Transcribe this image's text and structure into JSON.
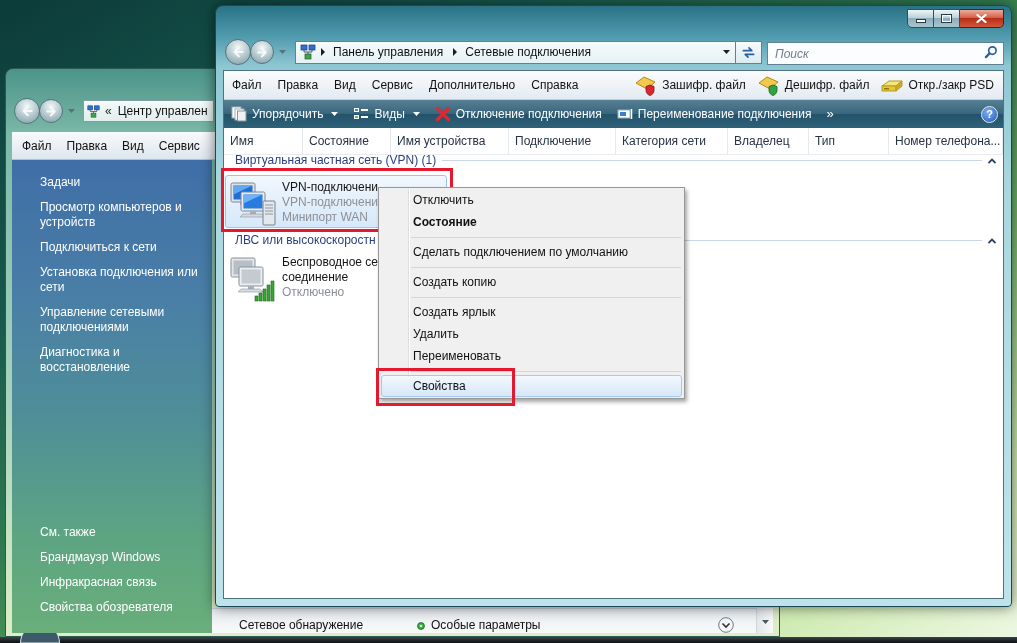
{
  "back_window": {
    "address": {
      "overflow": "«",
      "location": "Центр управлен"
    },
    "menu": [
      "Файл",
      "Правка",
      "Вид",
      "Сервис"
    ],
    "sidebar": [
      {
        "heading": "Задачи",
        "links": [
          "Просмотр компьютеров и устройств",
          "Подключиться к сети",
          "Установка подключения или сети",
          "Управление сетевыми подключениями",
          "Диагностика и восстановление"
        ]
      },
      {
        "heading": "См. также",
        "links": [
          "Брандмауэр Windows",
          "Инфракрасная связь",
          "Свойства обозревателя"
        ]
      }
    ],
    "details_row": {
      "label": "Сетевое обнаружение",
      "value": "Особые параметры"
    }
  },
  "front_window": {
    "address": {
      "path": [
        "Панель управления",
        "Сетевые подключения"
      ]
    },
    "search": {
      "placeholder": "Поиск"
    },
    "menu": [
      "Файл",
      "Правка",
      "Вид",
      "Сервис",
      "Дополнительно",
      "Справка"
    ],
    "tools": [
      {
        "kind": "encrypt",
        "label": "Зашифр. файл"
      },
      {
        "kind": "decrypt",
        "label": "Дешифр. файл"
      },
      {
        "kind": "drive",
        "label": "Откр./закр PSD"
      }
    ],
    "commands": [
      {
        "kind": "organize",
        "label": "Упорядочить",
        "dropdown": true
      },
      {
        "kind": "views",
        "label": "Виды",
        "dropdown": true
      },
      {
        "kind": "disconnect",
        "label": "Отключение подключения",
        "dropdown": false
      },
      {
        "kind": "rename",
        "label": "Переименование подключения",
        "dropdown": false
      }
    ],
    "more_commands": "»",
    "help": "?",
    "columns": [
      "Имя",
      "Состояние",
      "Имя устройства",
      "Подключение",
      "Категория сети",
      "Владелец",
      "Тип",
      "Номер телефона..."
    ],
    "groups": [
      {
        "title": "Виртуальная частная сеть (VPN) (1)",
        "expanded": true,
        "items": [
          {
            "kind": "vpn",
            "selected": true,
            "outlined": true,
            "name_lines": [
              "VPN-подключени"
            ],
            "details": [
              "VPN-подключени",
              "Минипорт WAN"
            ]
          }
        ]
      },
      {
        "title": "ЛВС или высокоскоростн",
        "expanded": true,
        "items": [
          {
            "kind": "wireless",
            "selected": false,
            "outlined": false,
            "name_lines": [
              "Беспроводное се",
              "соединение"
            ],
            "details": [
              "Отключено"
            ]
          }
        ]
      }
    ],
    "context_menu": {
      "sections": [
        {
          "items": [
            {
              "label": "Отключить",
              "default": false,
              "selected": false,
              "outlined": false
            },
            {
              "label": "Состояние",
              "default": true,
              "selected": false,
              "outlined": false
            }
          ]
        },
        {
          "items": [
            {
              "label": "Сделать подключением по умолчанию",
              "default": false,
              "selected": false,
              "outlined": false
            }
          ]
        },
        {
          "items": [
            {
              "label": "Создать копию",
              "default": false,
              "selected": false,
              "outlined": false
            }
          ]
        },
        {
          "items": [
            {
              "label": "Создать ярлык",
              "default": false,
              "selected": false,
              "outlined": false
            },
            {
              "label": "Удалить",
              "default": false,
              "selected": false,
              "outlined": false
            },
            {
              "label": "Переименовать",
              "default": false,
              "selected": false,
              "outlined": false
            }
          ]
        },
        {
          "items": [
            {
              "label": "Свойства",
              "default": false,
              "selected": true,
              "outlined": true
            }
          ]
        }
      ]
    }
  }
}
